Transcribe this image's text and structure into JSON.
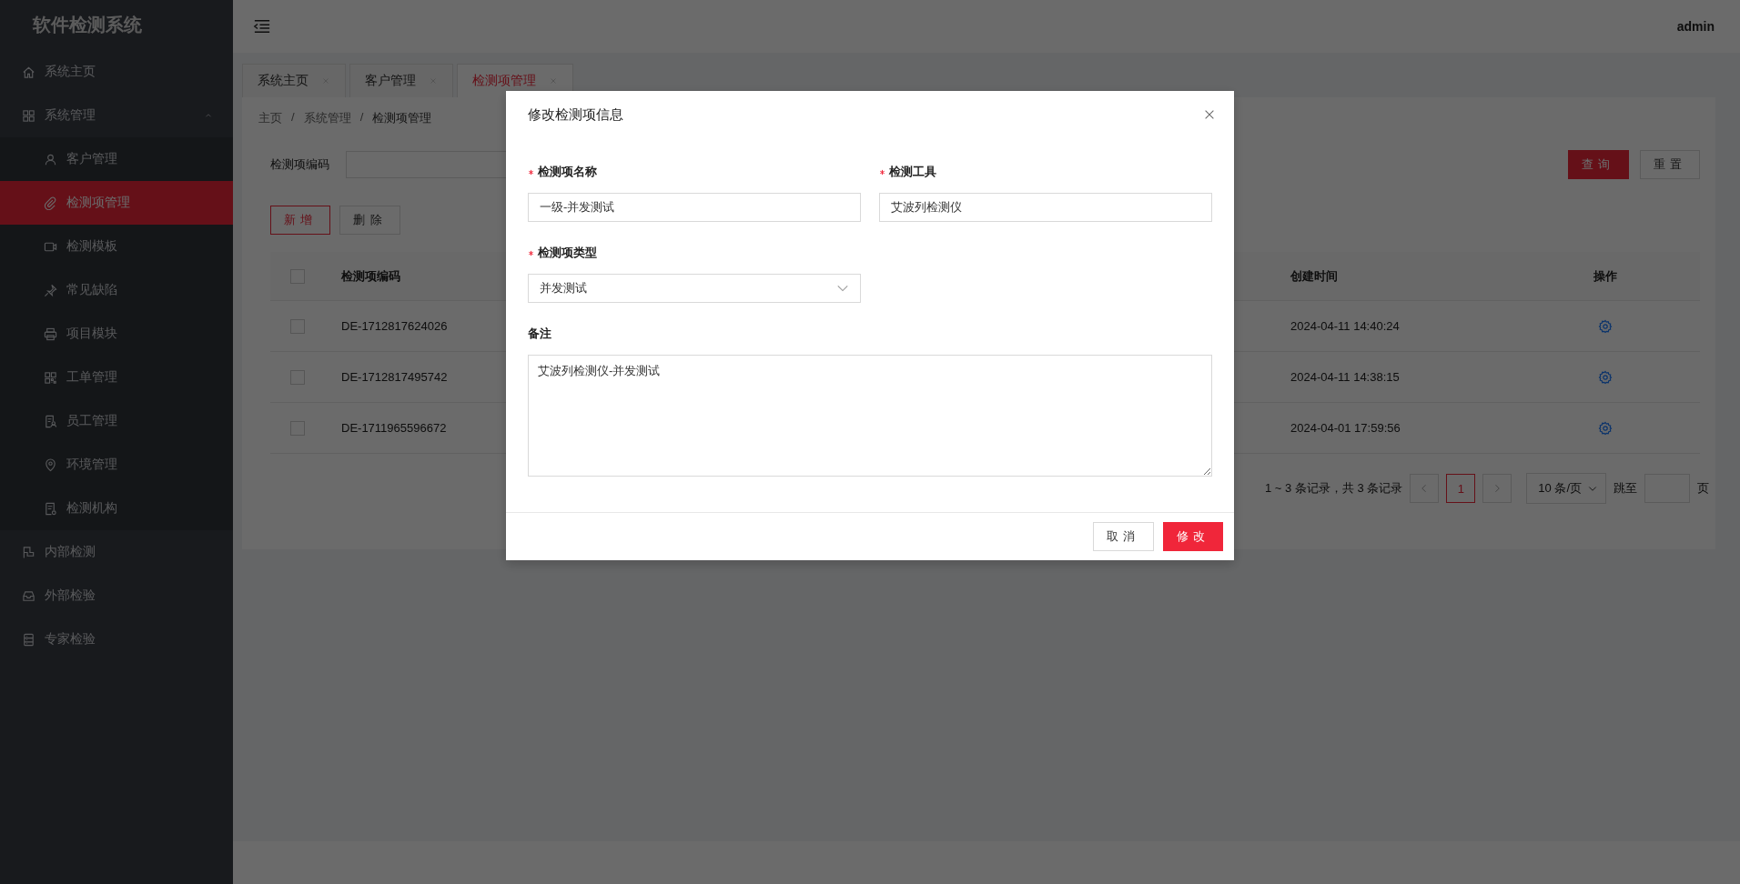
{
  "sidebar": {
    "title": "软件检测系统",
    "items": [
      {
        "label": "系统主页",
        "selected": false
      },
      {
        "label": "系统管理",
        "selected": false,
        "expanded": true,
        "children": [
          {
            "label": "客户管理",
            "selected": false
          },
          {
            "label": "检测项管理",
            "selected": true
          },
          {
            "label": "检测模板",
            "selected": false
          },
          {
            "label": "常见缺陷",
            "selected": false
          },
          {
            "label": "项目模块",
            "selected": false
          },
          {
            "label": "工单管理",
            "selected": false
          },
          {
            "label": "员工管理",
            "selected": false
          },
          {
            "label": "环境管理",
            "selected": false
          },
          {
            "label": "检测机构",
            "selected": false
          }
        ]
      },
      {
        "label": "内部检测",
        "selected": false
      },
      {
        "label": "外部检验",
        "selected": false
      },
      {
        "label": "专家检验",
        "selected": false
      }
    ]
  },
  "header": {
    "user": "admin"
  },
  "tabs": [
    {
      "label": "系统主页",
      "selected": false
    },
    {
      "label": "客户管理",
      "selected": false
    },
    {
      "label": "检测项管理",
      "selected": true
    }
  ],
  "breadcrumb": {
    "items": [
      "主页",
      "系统管理",
      "检测项管理"
    ],
    "separators": [
      "/",
      "/"
    ]
  },
  "search": {
    "label": "检测项编码",
    "buttons": [
      {
        "label": "查询",
        "kind": "primary"
      },
      {
        "label": "重置",
        "kind": "default"
      }
    ]
  },
  "actions": [
    {
      "label": "新增",
      "kind": "outline"
    },
    {
      "label": "删除",
      "kind": "default"
    }
  ],
  "table": {
    "columns": [
      "检测项编码",
      "创建时间",
      "操作"
    ],
    "header_checked": false,
    "rows": [
      {
        "checked": false,
        "code": "DE-1712817624026",
        "created": "2024-04-11 14:40:24"
      },
      {
        "checked": false,
        "code": "DE-1712817495742",
        "created": "2024-04-11 14:38:15"
      },
      {
        "checked": false,
        "code": "DE-1711965596672",
        "created": "2024-04-01 17:59:56"
      }
    ]
  },
  "pagination": {
    "summary": "1 ~ 3 条记录，共 3 条记录",
    "pages": [
      {
        "label": "1",
        "selected": true
      }
    ],
    "page_size": "10 条/页",
    "jump_label": "跳至",
    "jump_suffix": "页"
  },
  "dialog": {
    "title": "修改检测项信息",
    "fields": [
      {
        "kind": "text",
        "label": "检测项名称",
        "required": true,
        "value": "一级-并发测试"
      },
      {
        "kind": "text",
        "label": "检测工具",
        "required": true,
        "value": "艾波列检测仪"
      },
      {
        "kind": "select",
        "label": "检测项类型",
        "required": true,
        "value": "并发测试"
      },
      {
        "kind": "textarea",
        "label": "备注",
        "required": false,
        "value": "艾波列检测仪-并发测试"
      }
    ],
    "buttons": [
      {
        "label": "取消",
        "kind": "default"
      },
      {
        "label": "修改",
        "kind": "primary"
      }
    ]
  }
}
